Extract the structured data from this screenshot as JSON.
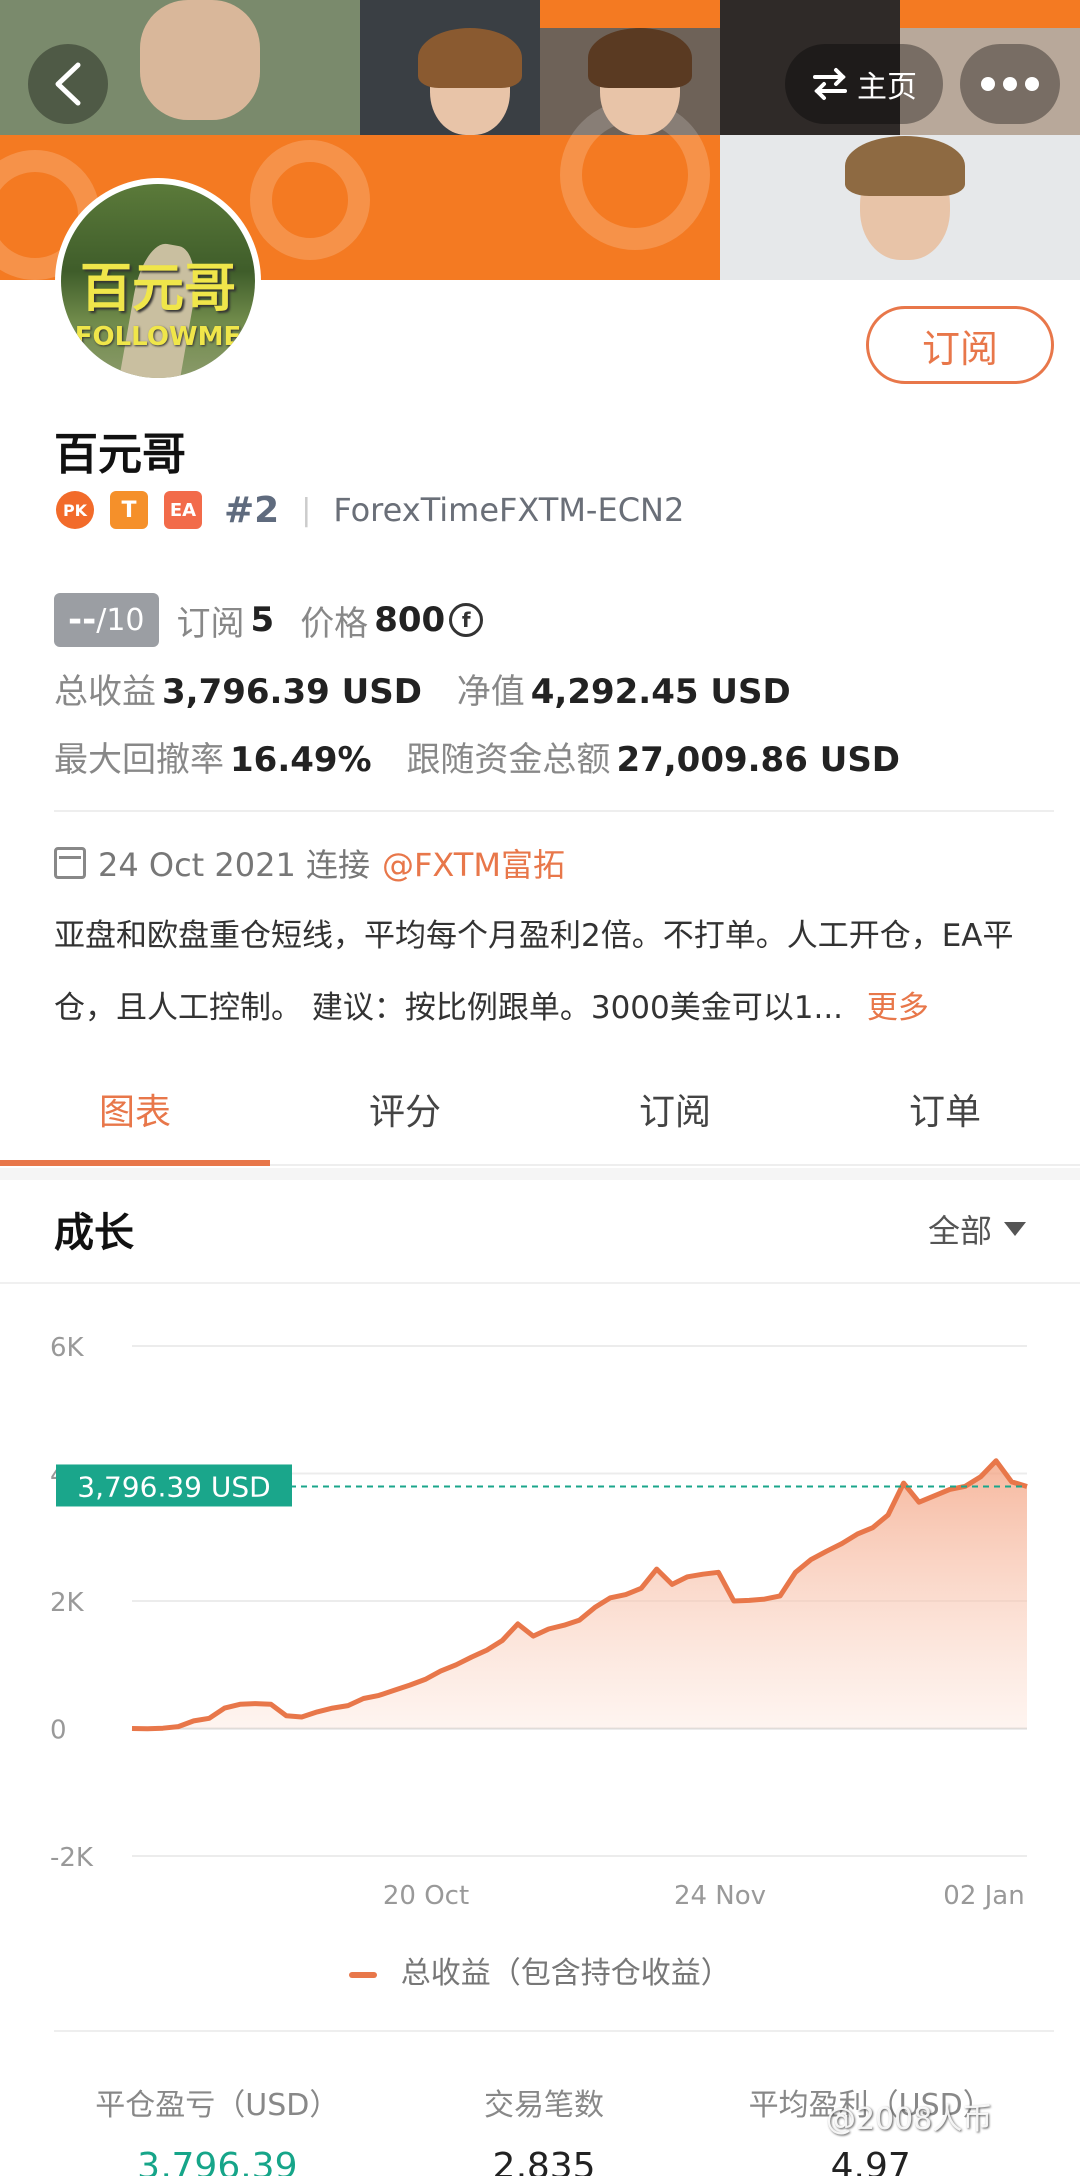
{
  "header": {
    "home_label": "主页"
  },
  "profile": {
    "name": "百元哥",
    "avatar_text": "百元哥",
    "avatar_subtext": "FOLLOWME",
    "subscribe_label": "订阅",
    "badges": [
      "PK",
      "T",
      "EA"
    ],
    "rank": "#2",
    "broker": "ForexTimeFXTM-ECN2"
  },
  "stats": {
    "score_value": "--",
    "score_max": "/10",
    "subscribe_label": "订阅",
    "subscribe_count": "5",
    "price_label": "价格",
    "price_value": "800",
    "coin_symbol": "f",
    "total_profit_label": "总收益",
    "total_profit_value": "3,796.39 USD",
    "equity_label": "净值",
    "equity_value": "4,292.45 USD",
    "max_drawdown_label": "最大回撤率",
    "max_drawdown_value": "16.49%",
    "follow_funds_label": "跟随资金总额",
    "follow_funds_value": "27,009.86 USD"
  },
  "connection": {
    "date": "24 Oct 2021 连接",
    "broker_link": "@FXTM富拓"
  },
  "description": {
    "text": "亚盘和欧盘重仓短线，平均每个月盈利2倍。不打单。人工开仓，EA平仓，且人工控制。 建议：按比例跟单。3000美金可以1...",
    "more_label": "更多"
  },
  "tabs": [
    "图表",
    "评分",
    "订阅",
    "订单"
  ],
  "growth": {
    "title": "成长",
    "filter_label": "全部"
  },
  "chart_data": {
    "type": "area",
    "title": "成长",
    "y_ticks": [
      "6K",
      "4K",
      "2K",
      "0",
      "-2K"
    ],
    "x_ticks": [
      "20 Oct",
      "24 Nov",
      "02 Jan"
    ],
    "ylim": [
      -2000,
      6000
    ],
    "current_label": "3,796.39 USD",
    "current_value": 3796.39,
    "series": [
      {
        "name": "总收益（包含持仓收益）",
        "color": "#e8774a",
        "values": [
          0,
          -5,
          5,
          30,
          120,
          160,
          320,
          380,
          390,
          380,
          200,
          180,
          260,
          320,
          360,
          470,
          520,
          600,
          680,
          770,
          900,
          1000,
          1120,
          1230,
          1380,
          1640,
          1450,
          1560,
          1620,
          1700,
          1900,
          2050,
          2100,
          2200,
          2500,
          2260,
          2380,
          2420,
          2450,
          2000,
          2010,
          2030,
          2080,
          2450,
          2650,
          2780,
          2900,
          3050,
          3150,
          3350,
          3850,
          3550,
          3650,
          3750,
          3800,
          3950,
          4200,
          3870,
          3796
        ]
      }
    ],
    "legend": "总收益（包含持仓收益）",
    "grid": true
  },
  "bottom": {
    "closed_pl_label": "平仓盈亏（USD）",
    "closed_pl_value": "3,796.39",
    "trades_label": "交易笔数",
    "trades_value": "2,835",
    "avg_profit_label": "平均盈利（USD）",
    "avg_profit_value": "4.97"
  },
  "watermark": "@2008人币",
  "colors": {
    "accent": "#e8774a",
    "green": "#16a589",
    "teal_label": "#1aa68b"
  }
}
